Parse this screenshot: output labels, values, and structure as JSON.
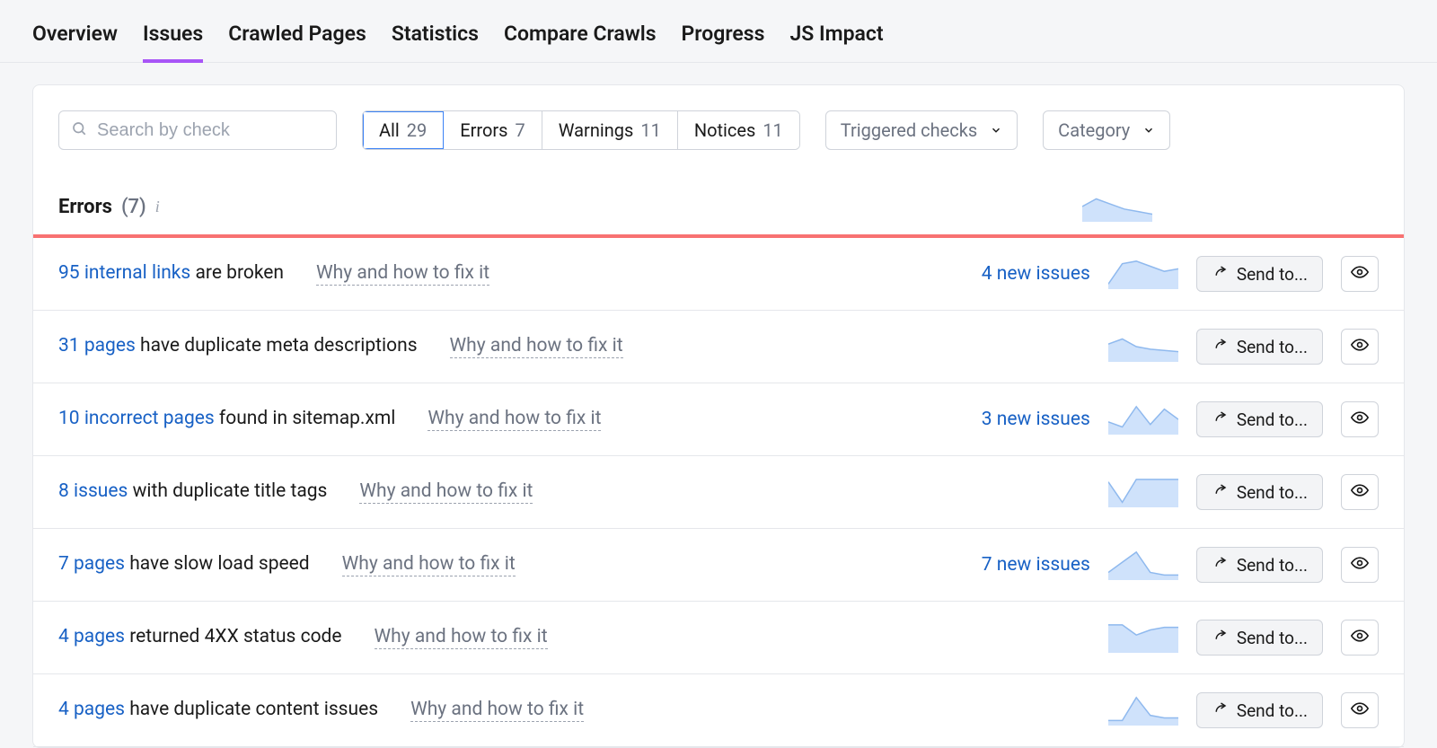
{
  "nav": {
    "tabs": [
      {
        "label": "Overview",
        "active": false
      },
      {
        "label": "Issues",
        "active": true
      },
      {
        "label": "Crawled Pages",
        "active": false
      },
      {
        "label": "Statistics",
        "active": false
      },
      {
        "label": "Compare Crawls",
        "active": false
      },
      {
        "label": "Progress",
        "active": false
      },
      {
        "label": "JS Impact",
        "active": false
      }
    ]
  },
  "filters": {
    "search_placeholder": "Search by check",
    "segments": [
      {
        "label": "All",
        "count": "29",
        "active": true
      },
      {
        "label": "Errors",
        "count": "7",
        "active": false
      },
      {
        "label": "Warnings",
        "count": "11",
        "active": false
      },
      {
        "label": "Notices",
        "count": "11",
        "active": false
      }
    ],
    "triggered_label": "Triggered checks",
    "category_label": "Category"
  },
  "section": {
    "title": "Errors",
    "count_display": "(7)",
    "spark": [
      12,
      18,
      14,
      10,
      8,
      6
    ]
  },
  "why_label": "Why and how to fix it",
  "sendto_label": "Send to...",
  "issues": [
    {
      "link": "95 internal links",
      "desc": "are broken",
      "new": "4 new issues",
      "spark": [
        4,
        20,
        22,
        18,
        14,
        16
      ]
    },
    {
      "link": "31 pages",
      "desc": "have duplicate meta descriptions",
      "new": "",
      "spark": [
        14,
        18,
        12,
        10,
        9,
        8
      ]
    },
    {
      "link": "10 incorrect pages",
      "desc": "found in sitemap.xml",
      "new": "3 new issues",
      "spark": [
        10,
        6,
        22,
        8,
        20,
        12
      ]
    },
    {
      "link": "8 issues",
      "desc": "with duplicate title tags",
      "new": "",
      "spark": [
        20,
        4,
        22,
        22,
        22,
        22
      ]
    },
    {
      "link": "7 pages",
      "desc": "have slow load speed",
      "new": "7 new issues",
      "spark": [
        6,
        14,
        22,
        6,
        4,
        4
      ]
    },
    {
      "link": "4 pages",
      "desc": "returned 4XX status code",
      "new": "",
      "spark": [
        22,
        22,
        14,
        18,
        20,
        20
      ]
    },
    {
      "link": "4 pages",
      "desc": "have duplicate content issues",
      "new": "",
      "spark": [
        4,
        4,
        22,
        8,
        6,
        6
      ]
    }
  ]
}
